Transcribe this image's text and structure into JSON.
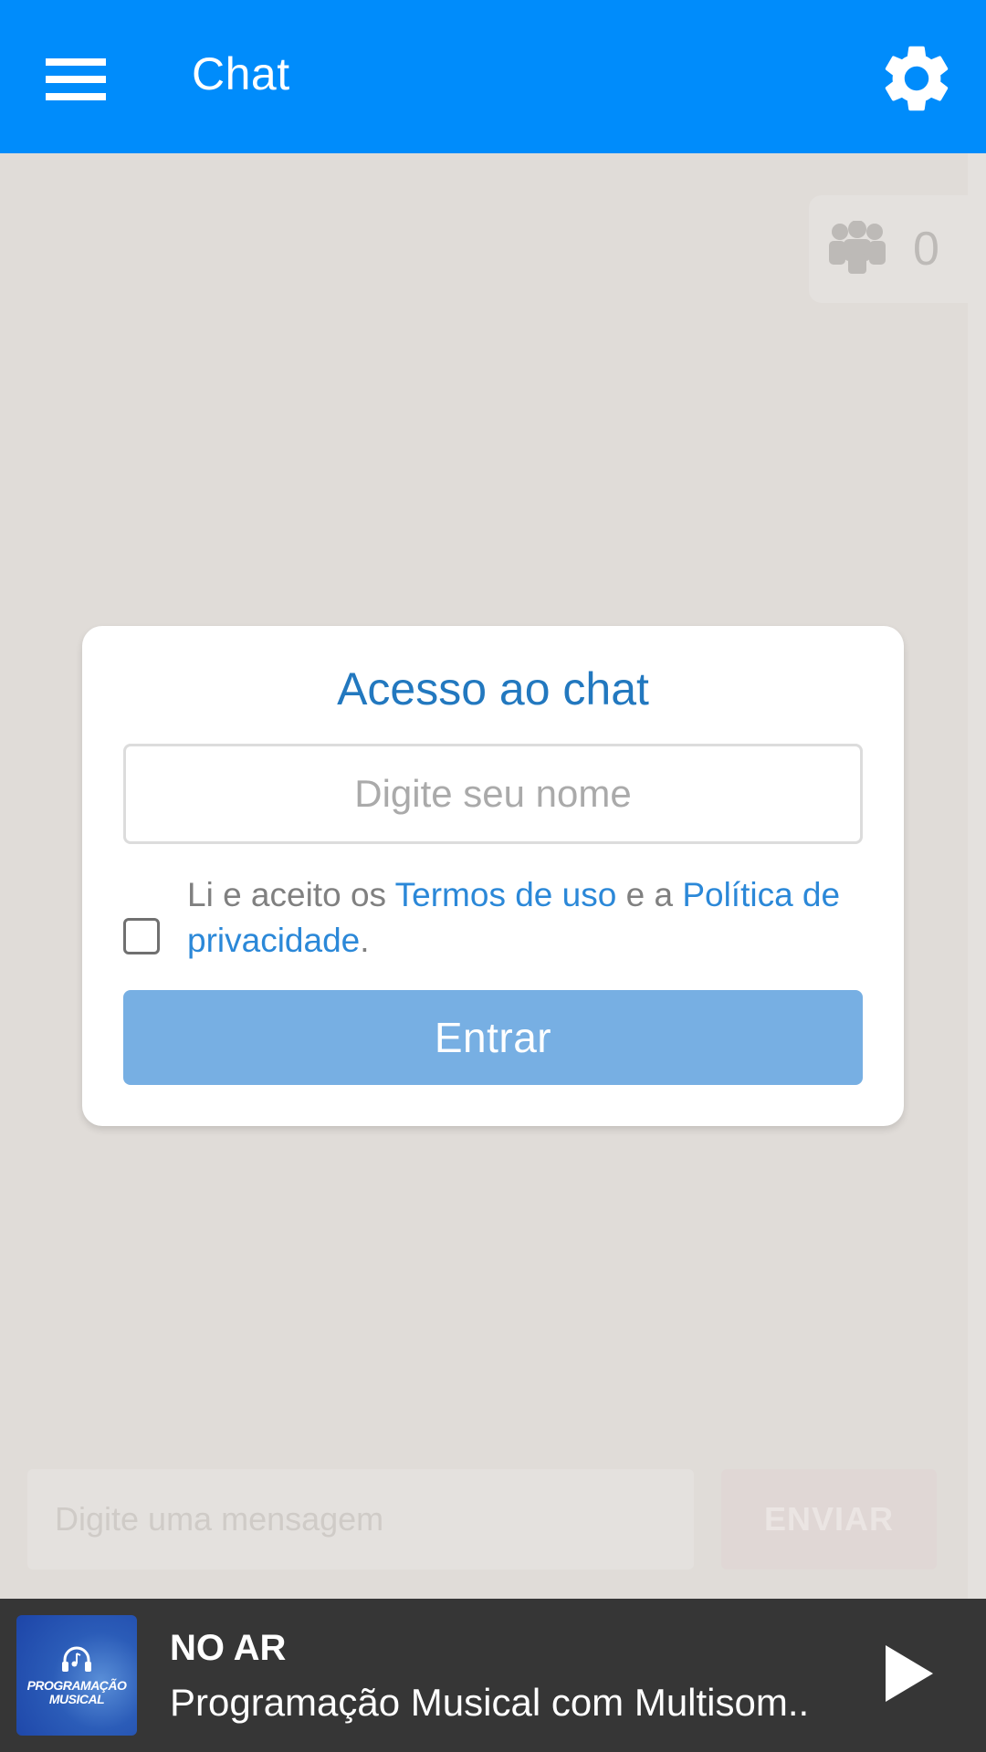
{
  "header": {
    "title": "Chat",
    "menu_icon": "hamburger-menu-icon",
    "settings_icon": "gear-icon",
    "background_color": "#008cfb"
  },
  "online_users": {
    "icon": "users-group-icon",
    "count": "0"
  },
  "composer": {
    "placeholder": "Digite uma mensagem",
    "send_label": "ENVIAR"
  },
  "login_modal": {
    "title": "Acesso ao chat",
    "name_placeholder": "Digite seu nome",
    "name_value": "",
    "terms": {
      "checked": false,
      "prefix": "Li e aceito os ",
      "terms_link": "Termos de uso",
      "middle": " e a ",
      "privacy_link": "Política de privacidade",
      "suffix": "."
    },
    "submit_label": "Entrar",
    "accent_color": "#2278bf",
    "button_color": "#77afe3"
  },
  "player": {
    "status_label": "NO AR",
    "track_title": "Programação Musical com Multisom..",
    "album_art": {
      "line1": "PROGRAMAÇÃO",
      "line2": "MUSICAL",
      "icon": "headphones-music-note-icon"
    },
    "play_icon": "play-icon"
  }
}
